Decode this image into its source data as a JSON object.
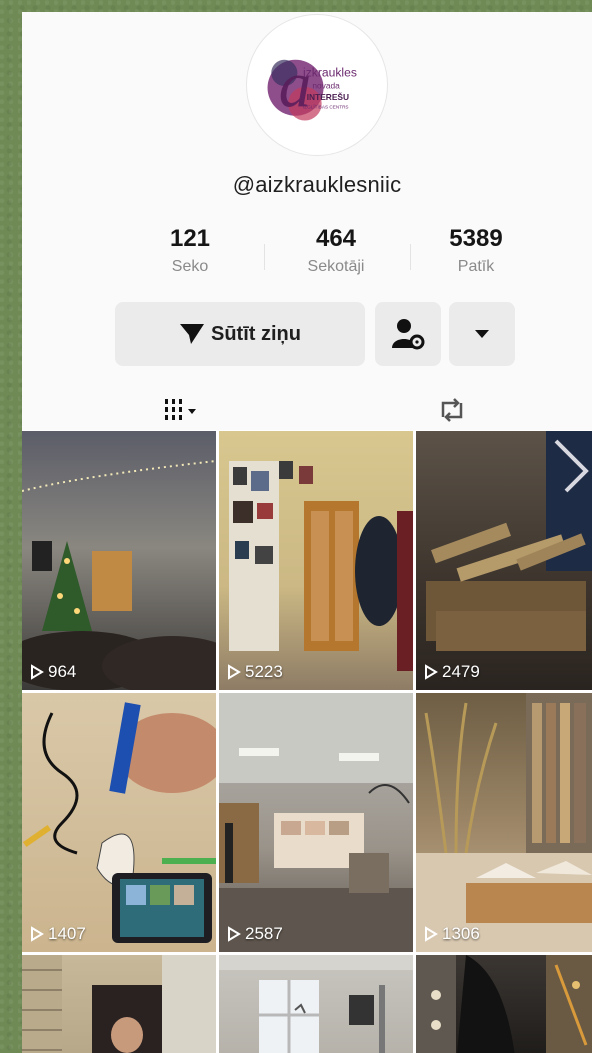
{
  "profile": {
    "username": "@aizkrauklesniic",
    "logo_text": [
      "izkraukles",
      "novada",
      "INTEREŠU",
      "IZGLĪTĪBAS CENTRS"
    ]
  },
  "stats": [
    {
      "value": "121",
      "label": "Seko"
    },
    {
      "value": "464",
      "label": "Sekotāji"
    },
    {
      "value": "5389",
      "label": "Patīk"
    }
  ],
  "actions": {
    "message_label": "Sūtīt ziņu",
    "icons": [
      "send-icon",
      "user-settings-icon",
      "dropdown-icon"
    ]
  },
  "tabs": [
    {
      "name": "videos",
      "icon": "grid-icon",
      "active": true
    },
    {
      "name": "reposts",
      "icon": "repost-icon",
      "active": false
    }
  ],
  "videos": [
    {
      "views": "964"
    },
    {
      "views": "5223"
    },
    {
      "views": "2479"
    },
    {
      "views": "1407"
    },
    {
      "views": "2587"
    },
    {
      "views": "1306"
    },
    {
      "views": ""
    },
    {
      "views": ""
    },
    {
      "views": ""
    }
  ],
  "colors": {
    "background": "#6f8a55",
    "header": "#fafafa",
    "button": "#ebebeb",
    "text": "#161616",
    "muted": "#8a8a8a",
    "logo_purple": "#6b2a6e"
  }
}
